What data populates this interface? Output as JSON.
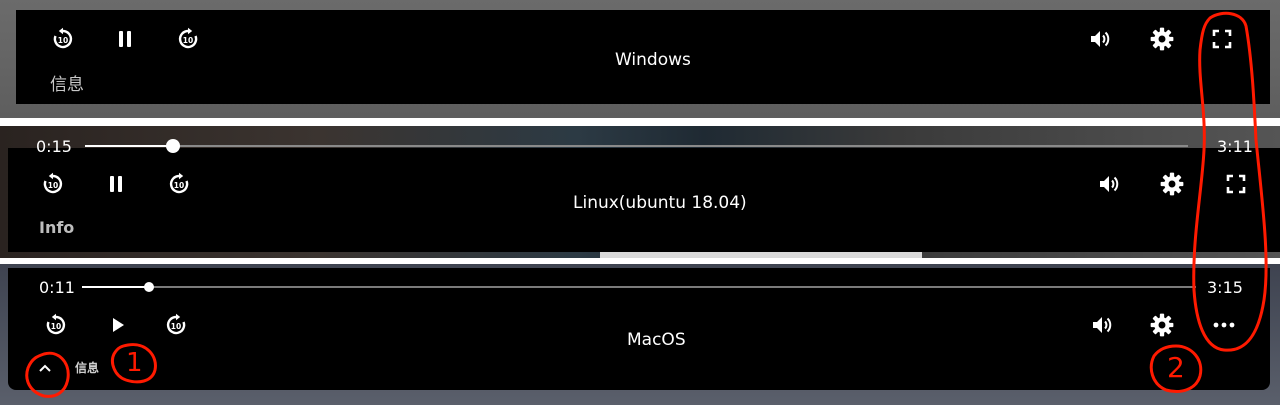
{
  "windows": {
    "title": "Windows",
    "info_label": "信息",
    "icons": [
      "replay-10-icon",
      "pause-icon",
      "forward-10-icon",
      "volume-icon",
      "settings-gear-icon",
      "fullscreen-icon"
    ]
  },
  "linux": {
    "title": "Linux(ubuntu 18.04)",
    "info_label": "Info",
    "current_time": "0:15",
    "duration": "3:11",
    "progress_fraction": 0.08,
    "icons": [
      "replay-10-icon",
      "pause-icon",
      "forward-10-icon",
      "volume-icon",
      "settings-gear-icon",
      "fullscreen-icon"
    ]
  },
  "macos": {
    "title": "MacOS",
    "info_label": "信息",
    "current_time": "0:11",
    "duration": "3:15",
    "progress_fraction": 0.06,
    "icons": [
      "replay-10-icon",
      "play-icon",
      "forward-10-icon",
      "volume-icon",
      "settings-gear-icon",
      "more-horizontal-icon",
      "chevron-up-icon"
    ]
  },
  "annotations": {
    "mark_1": "1",
    "mark_2": "2",
    "color": "#ff1a00"
  }
}
